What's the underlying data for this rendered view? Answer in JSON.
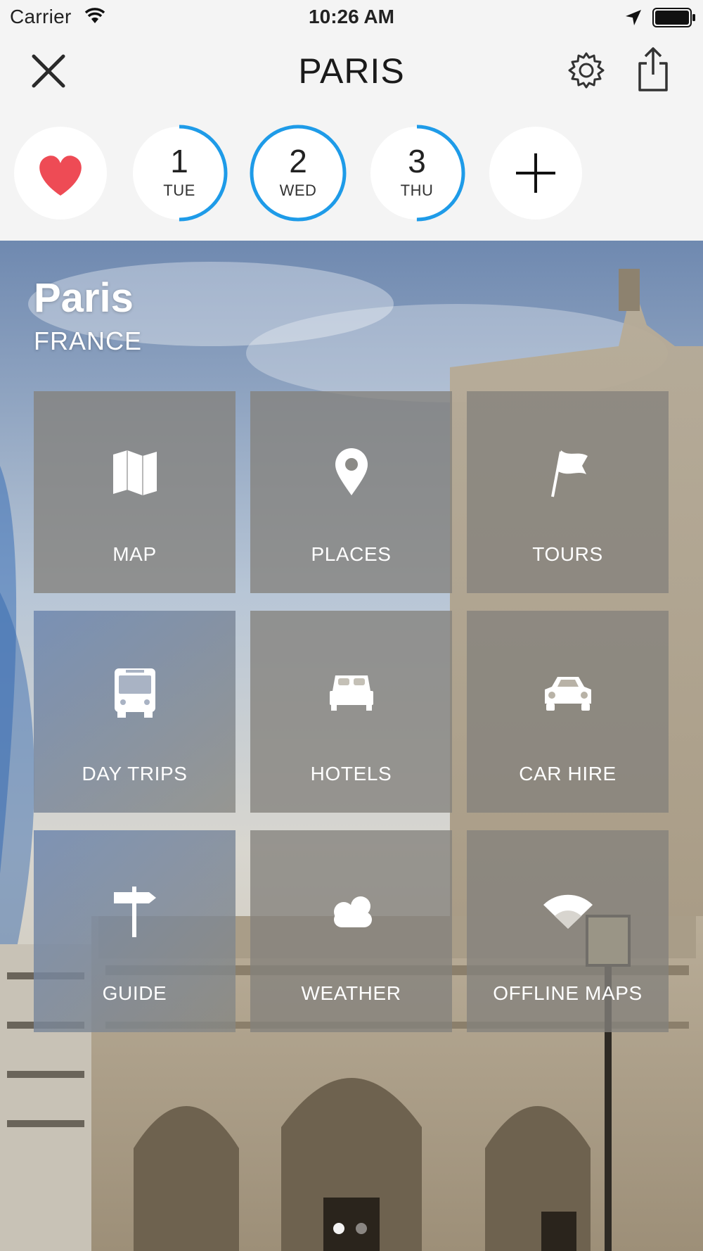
{
  "status_bar": {
    "carrier": "Carrier",
    "time": "10:26 AM"
  },
  "nav": {
    "title": "PARIS"
  },
  "days": [
    {
      "num": "1",
      "name": "TUE",
      "progress": 0.5
    },
    {
      "num": "2",
      "name": "WED",
      "progress": 1.0
    },
    {
      "num": "3",
      "name": "THU",
      "progress": 0.5
    }
  ],
  "hero": {
    "city": "Paris",
    "country": "FRANCE"
  },
  "tiles": [
    {
      "label": "MAP",
      "icon": "map-icon"
    },
    {
      "label": "PLACES",
      "icon": "location-pin-icon"
    },
    {
      "label": "TOURS",
      "icon": "flag-icon"
    },
    {
      "label": "DAY TRIPS",
      "icon": "bus-icon"
    },
    {
      "label": "HOTELS",
      "icon": "bed-icon"
    },
    {
      "label": "CAR HIRE",
      "icon": "car-icon"
    },
    {
      "label": "GUIDE",
      "icon": "signpost-icon"
    },
    {
      "label": "WEATHER",
      "icon": "cloud-icon"
    },
    {
      "label": "OFFLINE MAPS",
      "icon": "wifi-signal-icon"
    }
  ],
  "pager": {
    "total": 2,
    "active": 1
  },
  "colors": {
    "accent": "#1e9be8",
    "heart": "#ee4b55"
  }
}
